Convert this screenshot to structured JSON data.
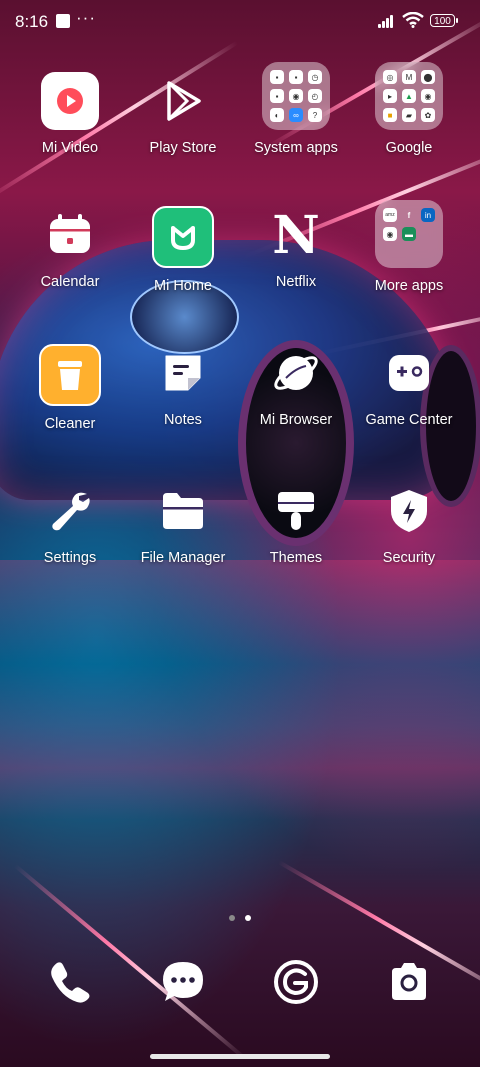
{
  "status_bar": {
    "time": "8:16",
    "notification_dots": "···",
    "battery_level": "100"
  },
  "home_screen": {
    "apps": [
      {
        "label": "Mi Video",
        "icon": "mi-video-icon"
      },
      {
        "label": "Play Store",
        "icon": "play-store-icon"
      },
      {
        "label": "System apps",
        "icon": "folder-icon"
      },
      {
        "label": "Google",
        "icon": "folder-icon"
      },
      {
        "label": "Calendar",
        "icon": "calendar-icon"
      },
      {
        "label": "Mi Home",
        "icon": "mi-home-icon"
      },
      {
        "label": "Netflix",
        "icon": "netflix-icon"
      },
      {
        "label": "More apps",
        "icon": "folder-icon"
      },
      {
        "label": "Cleaner",
        "icon": "cleaner-icon"
      },
      {
        "label": "Notes",
        "icon": "notes-icon"
      },
      {
        "label": "Mi Browser",
        "icon": "browser-icon"
      },
      {
        "label": "Game Center",
        "icon": "gamepad-icon"
      },
      {
        "label": "Settings",
        "icon": "wrench-icon"
      },
      {
        "label": "File Manager",
        "icon": "folder-files-icon"
      },
      {
        "label": "Themes",
        "icon": "paintbrush-icon"
      },
      {
        "label": "Security",
        "icon": "shield-icon"
      }
    ],
    "netflix_letter": "N"
  },
  "page_indicator": {
    "pages": 2,
    "current": 2
  },
  "dock": [
    {
      "icon": "phone-icon"
    },
    {
      "icon": "messages-icon"
    },
    {
      "icon": "browser-g-icon"
    },
    {
      "icon": "camera-icon"
    }
  ],
  "colors": {
    "mi_video_accent": "#ff4d5a",
    "mi_home_green": "#1fbf7a",
    "cleaner_orange": "#ffb02e",
    "page_dot_inactive": "#8a8a8a",
    "page_dot_active": "#ffffff"
  }
}
